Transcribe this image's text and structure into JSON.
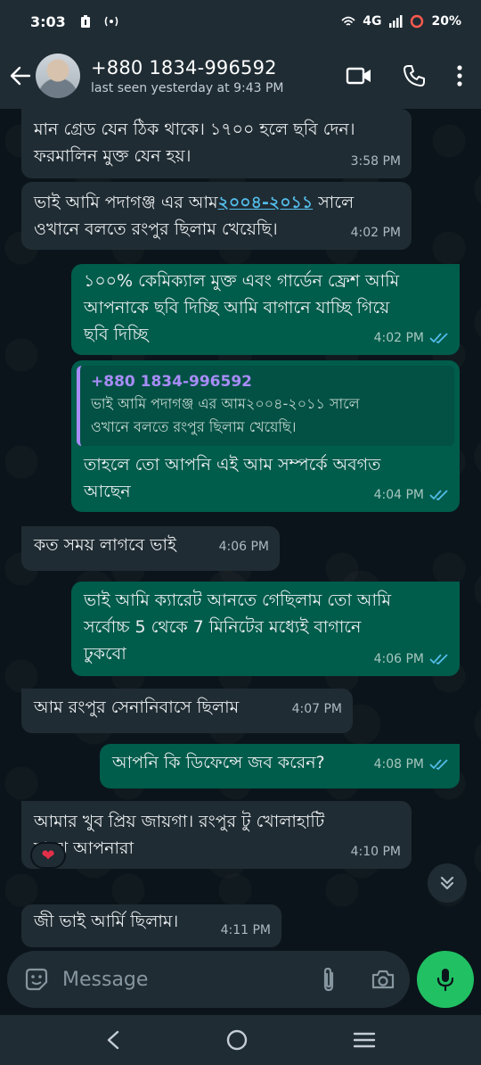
{
  "status_bar": {
    "time": "3:03",
    "network": "4G",
    "battery": "20%"
  },
  "header": {
    "contact_name": "+880 1834-996592",
    "last_seen": "last seen yesterday at 9:43 PM",
    "icons": [
      "back-arrow-icon",
      "video-call-icon",
      "voice-call-icon",
      "more-vert-icon"
    ]
  },
  "messages": [
    {
      "dir": "in",
      "lines": [
        "মান গ্রেড যেন ঠিক থাকে। ১৭০০ হলে ছবি দেন।",
        "ফরমালিন মুক্ত যেন হয়।"
      ],
      "time": "3:58 PM"
    },
    {
      "dir": "in",
      "line1_pre": "ভাই আমি পদাগঞ্জ এর আম",
      "line1_link": "২০০৪-২০১১",
      "line1_post": " সালে",
      "line2": "ওখানে বলতে রংপুর  ছিলাম খেয়েছি।",
      "time": "4:02 PM"
    },
    {
      "dir": "out",
      "lines": [
        "১০০% কেমিক্যাল মুক্ত এবং গার্ডেন ফ্রেশ আমি",
        "আপনাকে ছবি দিচ্ছি আমি বাগানে যাচ্ছি গিয়ে",
        "ছবি দিচ্ছি"
      ],
      "time": "4:02 PM"
    },
    {
      "dir": "out",
      "quote_name": "+880 1834-996592",
      "quote_lines": [
        "ভাই আমি পদাগঞ্জ এর আম২০০৪-২০১১ সালে",
        "ওখানে বলতে রংপুর  ছিলাম খেয়েছি।"
      ],
      "lines": [
        "তাহলে তো আপনি এই আম সম্পর্কে অবগত",
        "আছেন"
      ],
      "time": "4:04 PM"
    },
    {
      "dir": "in",
      "lines": [
        "কত সময় লাগবে ভাই"
      ],
      "time": "4:06 PM"
    },
    {
      "dir": "out",
      "lines": [
        "ভাই আমি ক্যারেট আনতে গেছিলাম তো আমি",
        "সর্বোচ্চ 5 থেকে 7 মিনিটের মধ্যেই বাগানে",
        "ঢুকবো"
      ],
      "time": "4:06 PM"
    },
    {
      "dir": "in",
      "lines": [
        "আম রংপুর সেনানিবাসে ছিলাম"
      ],
      "time": "4:07 PM"
    },
    {
      "dir": "out",
      "lines": [
        "আপনি কি ডিফেন্সে জব করেন?"
      ],
      "time": "4:08 PM"
    },
    {
      "dir": "in",
      "lines": [
        "আমার খুব প্রিয় জায়গা। রংপুর  টু খোলাহাটি",
        "মাঝে আপনারা"
      ],
      "time": "4:10 PM",
      "reaction": "❤"
    },
    {
      "dir": "in",
      "lines": [
        "জী ভাই আর্মি ছিলাম।"
      ],
      "time": "4:11 PM"
    }
  ],
  "composer": {
    "placeholder": "Message"
  },
  "colors": {
    "incoming": "#202c33",
    "outgoing": "#005c4b",
    "read_ticks": "#53bdeb",
    "mic_button": "#21c063"
  }
}
